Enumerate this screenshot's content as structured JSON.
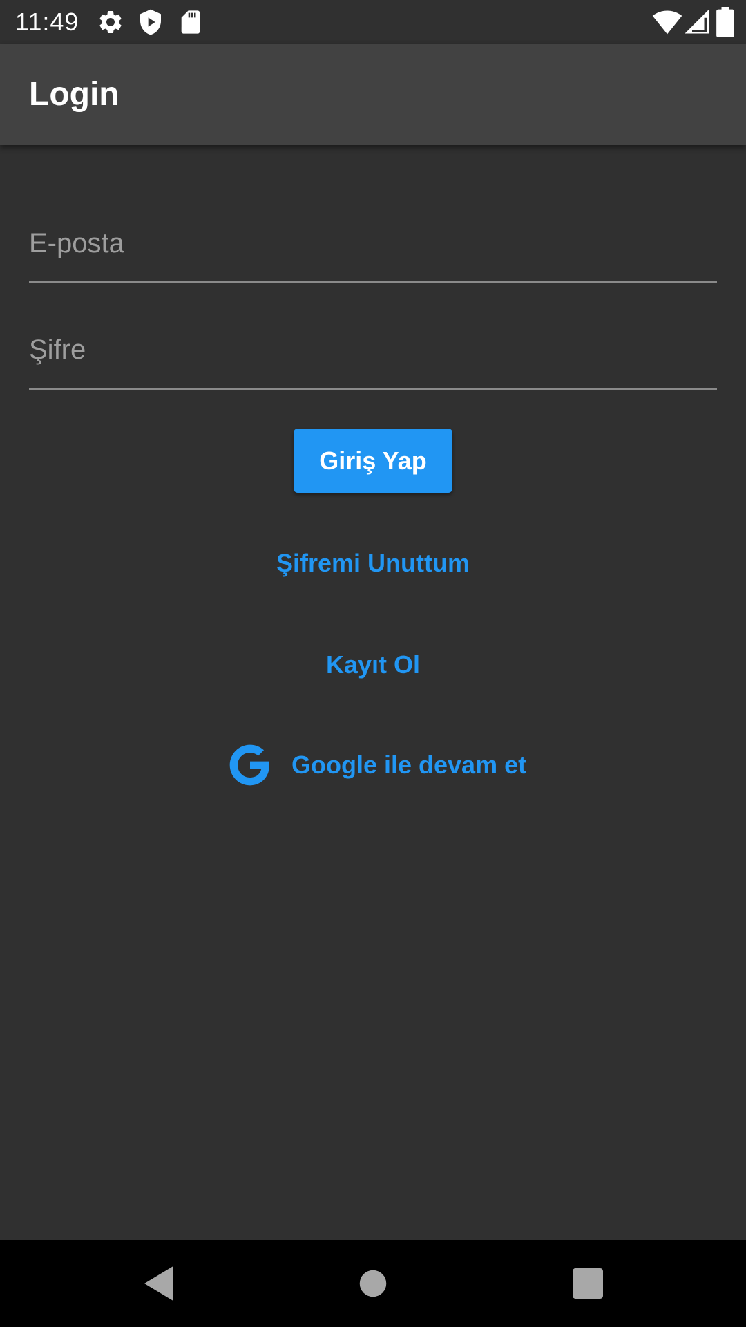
{
  "status_bar": {
    "time": "11:49",
    "icons": [
      "settings-icon",
      "shield-icon",
      "sd-card-icon",
      "wifi-icon",
      "cellular-signal-icon",
      "battery-icon"
    ]
  },
  "app_bar": {
    "title": "Login"
  },
  "form": {
    "email": {
      "placeholder": "E-posta",
      "value": ""
    },
    "password": {
      "placeholder": "Şifre",
      "value": ""
    },
    "login_button_label": "Giriş Yap",
    "forgot_password_label": "Şifremi Unuttum",
    "register_label": "Kayıt Ol",
    "google_label": "Google ile devam et"
  },
  "nav_bar": {
    "icons": [
      "back-icon",
      "home-icon",
      "recents-icon"
    ]
  },
  "colors": {
    "background": "#303030",
    "app_bar": "#424242",
    "accent": "#2196f3",
    "text_primary": "#ffffff",
    "text_hint": "#9e9e9e"
  }
}
